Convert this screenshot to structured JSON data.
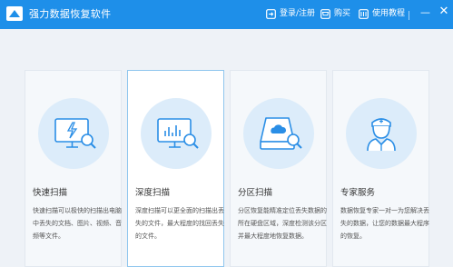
{
  "app": {
    "title": "强力数据恢复软件"
  },
  "titlebar": {
    "login_label": "登录/注册",
    "buy_label": "购买",
    "help_label": "使用教程",
    "minimize_symbol": "—",
    "close_symbol": "✕"
  },
  "cards": [
    {
      "title": "快速扫描",
      "desc": "快速扫描可以极快的扫描出电脑中丢失的文档、图片、视频、音频等文件。",
      "icon": "monitor-bolt-search-icon",
      "active": false
    },
    {
      "title": "深度扫描",
      "desc": "深度扫描可以更全面的扫描出丢失的文件，最大程度的找回丢失的文件。",
      "icon": "monitor-chart-search-icon",
      "active": true
    },
    {
      "title": "分区扫描",
      "desc": "分区恢复能精准定位丢失数据的所在硬盘区域，深度检测该分区并最大程度地恢复数据。",
      "icon": "drive-cloud-search-icon",
      "active": false
    },
    {
      "title": "专家服务",
      "desc": "数据恢复专家一对一为您解决丢失的数据，让您的数据最大程序的恢复。",
      "icon": "expert-person-icon",
      "active": false
    }
  ],
  "colors": {
    "titlebar": "#1e8fe9",
    "icon_stroke": "#2a8ee6",
    "circle_fill": "#dcecfa",
    "active_border": "#8fc6ee"
  }
}
